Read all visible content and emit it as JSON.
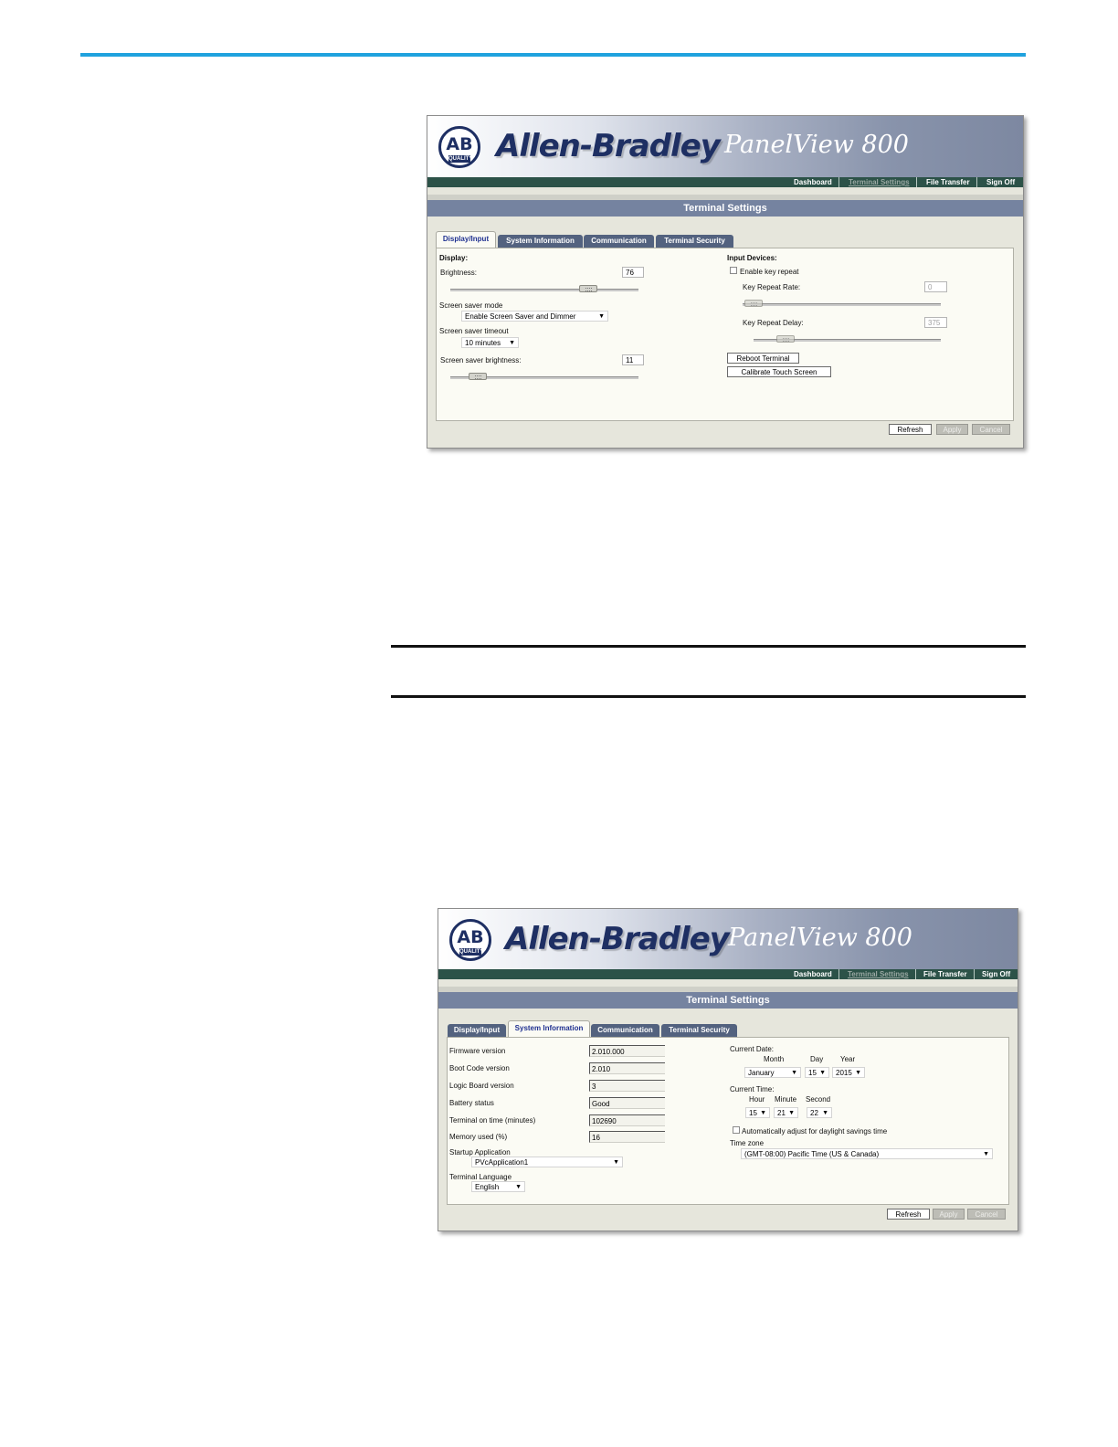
{
  "screenshot1": {
    "brand": "Allen-Bradley",
    "product": "PanelView 800",
    "logo": {
      "letters": "AB",
      "tag": "QUALITY"
    },
    "nav": [
      "Dashboard",
      "Terminal Settings",
      "File Transfer",
      "Sign Off"
    ],
    "title": "Terminal Settings",
    "tabs": [
      "Display/Input",
      "System Information",
      "Communication",
      "Terminal Security"
    ],
    "active_tab": "Display/Input",
    "display": {
      "heading": "Display:",
      "brightness_label": "Brightness:",
      "brightness_value": "76",
      "brightness_level": 0.76,
      "saver_mode_label": "Screen saver mode",
      "saver_mode_value": "Enable Screen Saver and Dimmer",
      "saver_timeout_label": "Screen saver timeout",
      "saver_timeout_value": "10 minutes",
      "saver_brightness_label": "Screen saver brightness:",
      "saver_brightness_value": "11",
      "saver_brightness_level": 0.11
    },
    "input": {
      "heading": "Input Devices:",
      "key_repeat_label": "Enable key repeat",
      "key_repeat_checked": false,
      "rate_label": "Key Repeat Rate:",
      "rate_value": "0",
      "delay_label": "Key Repeat Delay:",
      "delay_value": "375",
      "reboot_label": "Reboot Terminal",
      "calibrate_label": "Calibrate Touch Screen"
    },
    "buttons": {
      "refresh": "Refresh",
      "apply": "Apply",
      "cancel": "Cancel"
    }
  },
  "screenshot2": {
    "brand": "Allen-Bradley",
    "product": "PanelView 800",
    "logo": {
      "letters": "AB",
      "tag": "QUALITY"
    },
    "nav": [
      "Dashboard",
      "Terminal Settings",
      "File Transfer",
      "Sign Off"
    ],
    "title": "Terminal Settings",
    "tabs": [
      "Display/Input",
      "System Information",
      "Communication",
      "Terminal Security"
    ],
    "active_tab": "System Information",
    "info": [
      {
        "label": "Firmware version",
        "value": "2.010.000"
      },
      {
        "label": "Boot Code version",
        "value": "2.010"
      },
      {
        "label": "Logic Board version",
        "value": "3"
      },
      {
        "label": "Battery status",
        "value": "Good"
      },
      {
        "label": "Terminal on time (minutes)",
        "value": "102690"
      },
      {
        "label": "Memory used (%)",
        "value": "16"
      }
    ],
    "startup_label": "Startup Application",
    "startup_value": "PVcApplication1",
    "language_label": "Terminal Language",
    "language_value": "English",
    "date": {
      "label": "Current Date:",
      "month_label": "Month",
      "day_label": "Day",
      "year_label": "Year",
      "month": "January",
      "day": "15",
      "year": "2015"
    },
    "time": {
      "label": "Current Time:",
      "hour_label": "Hour",
      "minute_label": "Minute",
      "second_label": "Second",
      "hour": "15",
      "minute": "21",
      "second": "22"
    },
    "dst_label": "Automatically adjust for daylight savings time",
    "dst_checked": false,
    "timezone_label": "Time zone",
    "timezone_value": "(GMT-08:00) Pacific Time (US & Canada)",
    "buttons": {
      "refresh": "Refresh",
      "apply": "Apply",
      "cancel": "Cancel"
    }
  }
}
